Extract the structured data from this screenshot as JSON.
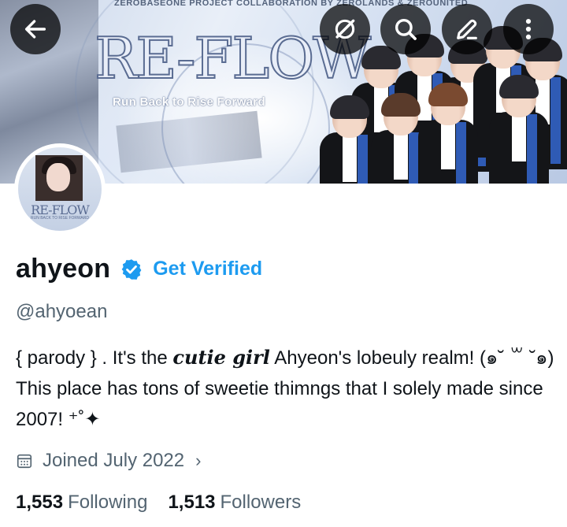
{
  "banner": {
    "top_line": "ZEROBASEONE PROJECT COLLABORATION BY ZEROLANDS & ZEROUNITED",
    "title": "RE-FLOW",
    "subtitle": "Run Back to Rise Forward"
  },
  "toolbar": {
    "back_icon": "arrow-left-icon",
    "grok_icon": "grok-slash-icon",
    "search_icon": "search-icon",
    "edit_icon": "pencil-icon",
    "more_icon": "more-vertical-icon"
  },
  "avatar": {
    "text": "RE-FLOW",
    "sub": "RUN BACK TO RISE FORWARD"
  },
  "profile": {
    "name": "ahyeon",
    "verified_icon": "verified-badge-icon",
    "get_verified": "Get Verified",
    "handle": "@ahyoean",
    "bio_part1": "{ parody } . It's the ",
    "bio_emph": "cutie girl",
    "bio_part2": " Ahyeon's lobeuly realm! (๑˘ ꒳ ˘๑) This place has tons of sweetie thimngs that I solely made since 2007! ⁺˚✦",
    "joined": "Joined July 2022",
    "following_count": "1,553",
    "following_label": "Following",
    "followers_count": "1,513",
    "followers_label": "Followers"
  },
  "colors": {
    "accent": "#1d9bf0",
    "muted": "#536471",
    "text": "#0f1419"
  }
}
